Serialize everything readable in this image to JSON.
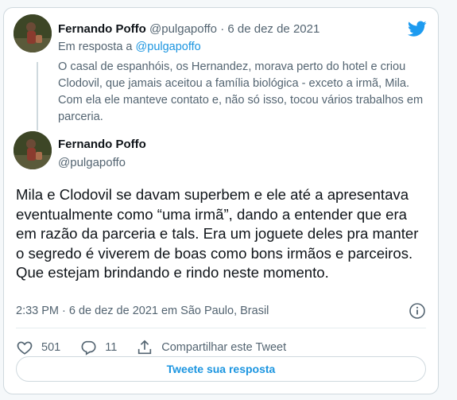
{
  "reply_tweet": {
    "author_name": "Fernando Poffo",
    "author_handle": "@pulgapoffo",
    "separator": "·",
    "date": "6 de dez de 2021",
    "in_reply_prefix": "Em resposta a",
    "in_reply_handle": "@pulgapoffo",
    "text": "O casal de espanhóis, os Hernandez, morava perto do hotel e criou Clodovil, que jamais aceitou a família biológica - exceto a irmã, Mila. Com ela ele manteve contato e, não só isso, tocou vários trabalhos em parceria."
  },
  "main_tweet": {
    "author_name": "Fernando Poffo",
    "author_handle": "@pulgapoffo",
    "text": "Mila e Clodovil se davam superbem e ele até a apresentava eventualmente como “uma irmã”, dando a entender que era em razão da parceria e tals. Era um joguete deles pra manter o segredo é viverem de boas como bons irmãos e parceiros.\nQue estejam brindando e rindo neste momento.",
    "timestamp": "2:33 PM · 6 de dez de 2021 em São Paulo, Brasil"
  },
  "actions": {
    "likes": "501",
    "replies": "11",
    "share_label": "Compartilhar este Tweet"
  },
  "reply_button_label": "Tweete sua resposta",
  "colors": {
    "twitter_blue": "#1b95e0",
    "muted_text": "#536471",
    "border": "#cfd9de"
  },
  "icons": [
    "twitter-bird-icon",
    "info-icon",
    "heart-icon",
    "comment-icon",
    "share-icon"
  ]
}
